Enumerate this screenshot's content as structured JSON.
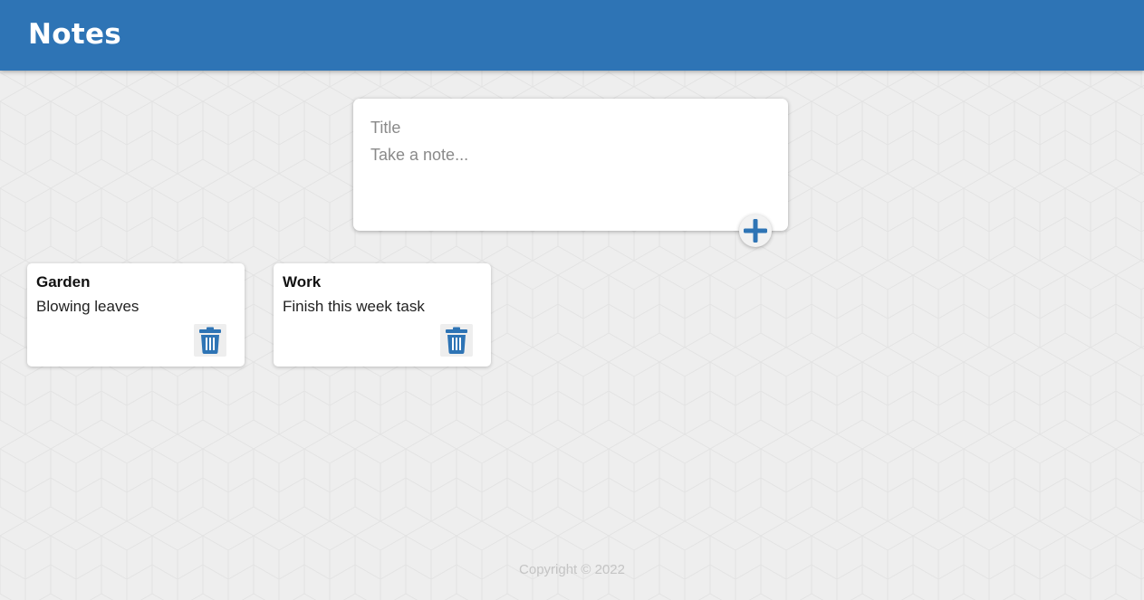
{
  "header": {
    "title": "Notes"
  },
  "composer": {
    "title_placeholder": "Title",
    "content_placeholder": "Take a note...",
    "add_icon": "plus-icon"
  },
  "notes": [
    {
      "title": "Garden",
      "content": "Blowing leaves",
      "delete_icon": "trash-icon"
    },
    {
      "title": "Work",
      "content": "Finish this week task",
      "delete_icon": "trash-icon"
    }
  ],
  "footer": {
    "text": "Copyright © 2022"
  },
  "colors": {
    "accent": "#2e74b5",
    "background": "#eeeeee",
    "card": "#ffffff",
    "footer_text": "#c4c4c4"
  }
}
